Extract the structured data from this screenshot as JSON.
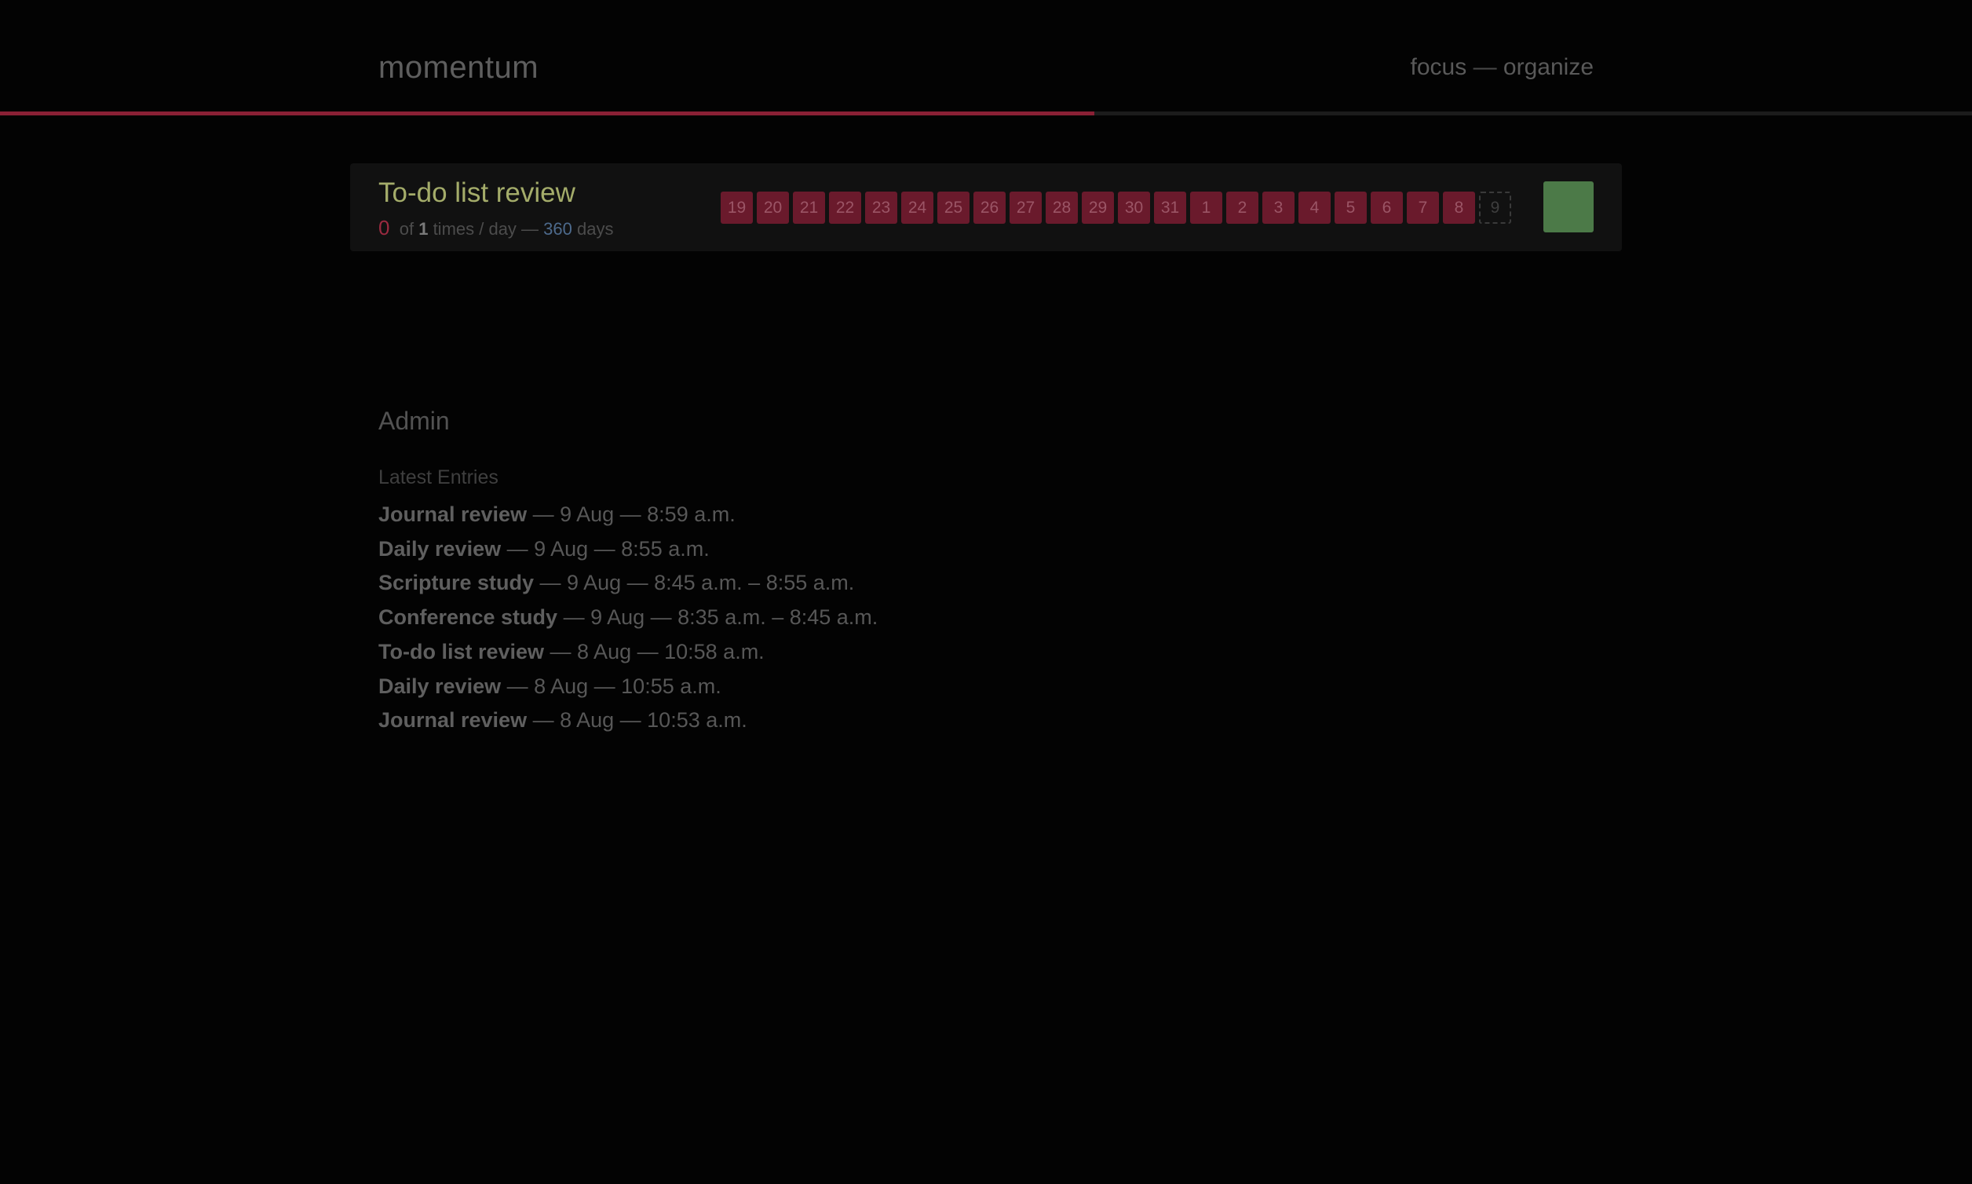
{
  "header": {
    "brand": "momentum",
    "nav": {
      "focus": "focus",
      "separator": " — ",
      "organize": "organize"
    },
    "progress_fraction": 0.555
  },
  "habit": {
    "name": "To-do list review",
    "done_count": "0",
    "of_text": "of",
    "target": "1",
    "per_text": "times / day —",
    "streak_days": "360",
    "days_text": "days",
    "history": [
      "19",
      "20",
      "21",
      "22",
      "23",
      "24",
      "25",
      "26",
      "27",
      "28",
      "29",
      "30",
      "31",
      "1",
      "2",
      "3",
      "4",
      "5",
      "6",
      "7",
      "8"
    ],
    "today": "9",
    "colors": {
      "missed": "#6a1a2c",
      "complete_button": "#4c7a48",
      "name": "#a4ac6a"
    }
  },
  "admin": {
    "title": "Admin",
    "subtitle": "Latest Entries",
    "entries": [
      {
        "name": "Journal review",
        "detail": " — 9 Aug — 8:59 a.m."
      },
      {
        "name": "Daily review",
        "detail": " — 9 Aug — 8:55 a.m."
      },
      {
        "name": "Scripture study",
        "detail": " — 9 Aug — 8:45 a.m. – 8:55 a.m."
      },
      {
        "name": "Conference study",
        "detail": " — 9 Aug — 8:35 a.m. – 8:45 a.m."
      },
      {
        "name": "To-do list review",
        "detail": " — 8 Aug — 10:58 a.m."
      },
      {
        "name": "Daily review",
        "detail": " — 8 Aug — 10:55 a.m."
      },
      {
        "name": "Journal review",
        "detail": " — 8 Aug — 10:53 a.m."
      }
    ]
  }
}
